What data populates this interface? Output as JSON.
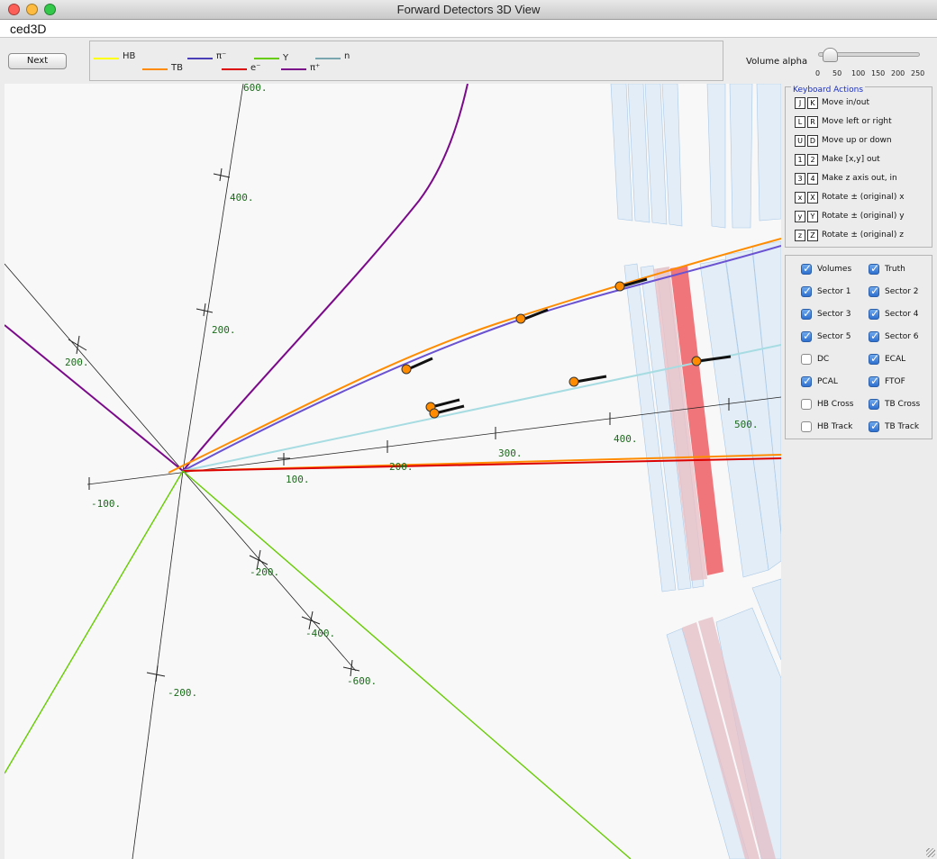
{
  "window": {
    "title": "Forward Detectors 3D View",
    "app_name": "ced3D",
    "buttons": [
      "close",
      "minimize",
      "zoom"
    ]
  },
  "toolbar": {
    "next_label": "Next",
    "legend": [
      {
        "label": "HB",
        "color": "#ffff00"
      },
      {
        "label": "TB",
        "color": "#ff8c00"
      },
      {
        "label": "π⁻",
        "color": "#4b3fb8"
      },
      {
        "label": "e⁻",
        "color": "#dd0000"
      },
      {
        "label": "Y",
        "color": "#66cc00"
      },
      {
        "label": "π⁺",
        "color": "#7a0a8a"
      },
      {
        "label": "n",
        "color": "#7aa6b0"
      }
    ],
    "volume": {
      "label": "Volume alpha",
      "ticks": [
        "0",
        "50",
        "100",
        "150",
        "200",
        "250"
      ],
      "value": 12
    }
  },
  "view": {
    "axis_labels": {
      "x_pos": [
        "100.",
        "200.",
        "300.",
        "400.",
        "500."
      ],
      "x_neg": [
        "-100."
      ],
      "y_pos": [
        "200.",
        "400.",
        "600."
      ],
      "y_neg": [
        "-200."
      ],
      "z_pos": [
        "200."
      ],
      "z_neg": [
        "-200.",
        "-400.",
        "-600."
      ]
    }
  },
  "keyboard": {
    "title": "Keyboard Actions",
    "rows": [
      {
        "k1": "J",
        "k2": "K",
        "text": "Move in/out"
      },
      {
        "k1": "L",
        "k2": "R",
        "text": "Move left or right"
      },
      {
        "k1": "U",
        "k2": "D",
        "text": "Move up or down"
      },
      {
        "k1": "1",
        "k2": "2",
        "text": "Make [x,y] out"
      },
      {
        "k1": "3",
        "k2": "4",
        "text": "Make z axis out, in"
      },
      {
        "k1": "x",
        "k2": "X",
        "text": "Rotate ± (original) x"
      },
      {
        "k1": "y",
        "k2": "Y",
        "text": "Rotate ± (original) y"
      },
      {
        "k1": "z",
        "k2": "Z",
        "text": "Rotate ± (original) z"
      }
    ]
  },
  "checkboxes": [
    {
      "label": "Volumes",
      "checked": true
    },
    {
      "label": "Truth",
      "checked": true
    },
    {
      "label": "Sector 1",
      "checked": true
    },
    {
      "label": "Sector 2",
      "checked": true
    },
    {
      "label": "Sector 3",
      "checked": true
    },
    {
      "label": "Sector 4",
      "checked": true
    },
    {
      "label": "Sector 5",
      "checked": true
    },
    {
      "label": "Sector 6",
      "checked": true
    },
    {
      "label": "DC",
      "checked": false
    },
    {
      "label": "ECAL",
      "checked": true
    },
    {
      "label": "PCAL",
      "checked": true
    },
    {
      "label": "FTOF",
      "checked": true
    },
    {
      "label": "HB Cross",
      "checked": false
    },
    {
      "label": "TB Cross",
      "checked": true
    },
    {
      "label": "HB Track",
      "checked": false
    },
    {
      "label": "TB Track",
      "checked": true
    }
  ]
}
